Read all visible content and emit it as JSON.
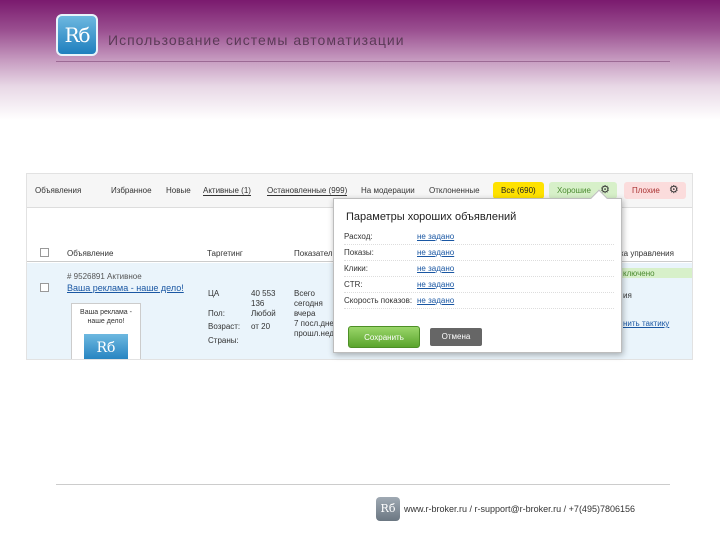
{
  "slide": {
    "logo_text": "Rб",
    "title": "Использование системы автоматизации",
    "footer": "www.r-broker.ru / r-support@r-broker.ru / +7(495)7806156",
    "footer_logo_text": "Rб"
  },
  "tabs": {
    "items": [
      {
        "label": "Объявления"
      },
      {
        "label": "Избранное"
      },
      {
        "label": "Новые"
      },
      {
        "label": "Активные (1)"
      },
      {
        "label": "Остановленные (999)"
      },
      {
        "label": "На модерации"
      },
      {
        "label": "Отклоненные"
      }
    ],
    "pill_all": "Все (690)",
    "pill_good": "Хорошие",
    "pill_bad": "Плохие",
    "gear": "⚙"
  },
  "table": {
    "headers": {
      "ad": "Объявление",
      "targeting": "Таргетинг",
      "stats": "Показател",
      "manage": "ка управления"
    },
    "row": {
      "id": "# 9526891 Активное",
      "title": "Ваша реклама - наше дело!",
      "thumb_caption": "Ваша реклама - наше дело!",
      "thumb_logo": "Rб",
      "targeting_labels": [
        "ЦА",
        "Пол:",
        "Возраст:",
        "Страны:"
      ],
      "targeting_values": [
        "40 553",
        "136",
        "Любой",
        "от 20"
      ],
      "stats_lines": [
        "Всего",
        "сегодня",
        "вчера",
        "7 посл.дне",
        "прошл.нед"
      ],
      "manage_line1": "ключено",
      "manage_line2": "ия",
      "manage_link": "нить тактику"
    }
  },
  "popup": {
    "title": "Параметры хороших объявлений",
    "rows": [
      {
        "label": "Расход:",
        "value": "не задано"
      },
      {
        "label": "Показы:",
        "value": "не задано"
      },
      {
        "label": "Клики:",
        "value": "не задано"
      },
      {
        "label": "CTR:",
        "value": "не задано"
      },
      {
        "label": "Скорость показов:",
        "value": "не задано"
      }
    ],
    "save_label": "Сохранить",
    "cancel_label": "Отмена"
  }
}
